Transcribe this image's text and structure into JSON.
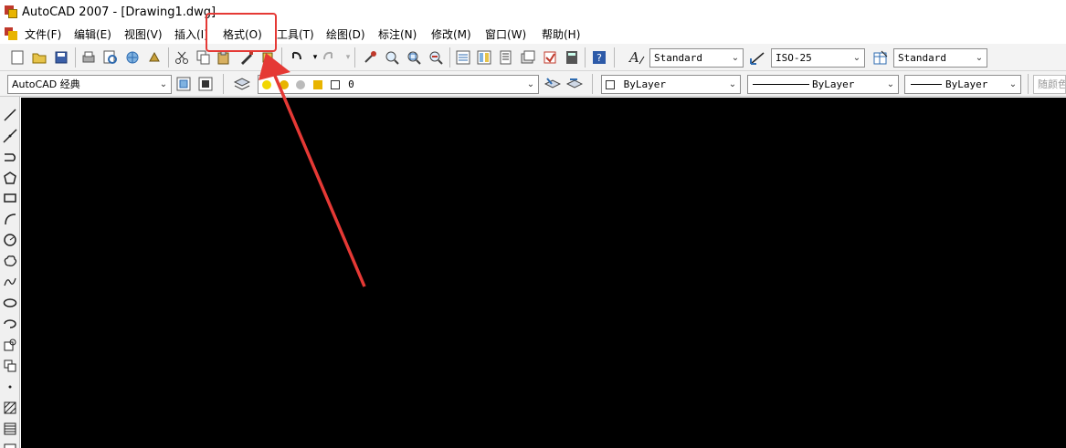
{
  "window": {
    "title": "AutoCAD 2007 - [Drawing1.dwg]"
  },
  "menubar": {
    "items": [
      "文件(F)",
      "编辑(E)",
      "视图(V)",
      "插入(I)",
      "格式(O)",
      "工具(T)",
      "绘图(D)",
      "标注(N)",
      "修改(M)",
      "窗口(W)",
      "帮助(H)"
    ]
  },
  "toolbar_styles": {
    "text_style": "Standard",
    "dim_style": "ISO-25",
    "table_style": "Standard"
  },
  "toolbar_layers": {
    "workspace": "AutoCAD 经典",
    "layer": "0",
    "color": "ByLayer",
    "linetype": "ByLayer",
    "lineweight": "ByLayer",
    "plot_style": "随颜色"
  },
  "icons": {
    "title": "autocad-app-icon",
    "menu": "document-icon",
    "help": "help-icon"
  },
  "annotation": {
    "highlight_color": "#e53935",
    "arrow_color": "#e53935"
  }
}
